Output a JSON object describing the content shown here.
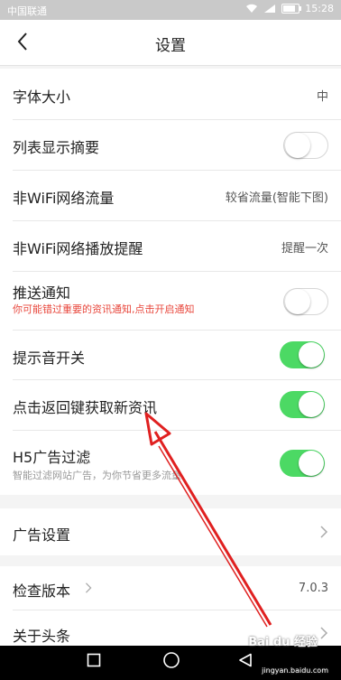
{
  "status_bar": {
    "carrier": "中国联通",
    "time": "15:28",
    "battery_level": 0.8
  },
  "header": {
    "title": "设置"
  },
  "settings": {
    "font_size": {
      "label": "字体大小",
      "value": "中"
    },
    "list_summary": {
      "label": "列表显示摘要",
      "enabled": false
    },
    "non_wifi_traffic": {
      "label": "非WiFi网络流量",
      "value": "较省流量(智能下图)"
    },
    "non_wifi_play": {
      "label": "非WiFi网络播放提醒",
      "value": "提醒一次"
    },
    "push": {
      "label": "推送通知",
      "subtitle": "你可能错过重要的资讯通知,点击开启通知",
      "enabled": false
    },
    "sound": {
      "label": "提示音开关",
      "enabled": true
    },
    "back_refresh": {
      "label": "点击返回键获取新资讯",
      "enabled": true
    },
    "h5_filter": {
      "label": "H5广告过滤",
      "subtitle": "智能过滤网站广告，为你节省更多流量",
      "enabled": true
    },
    "ads": {
      "label": "广告设置"
    },
    "version": {
      "label": "检查版本",
      "value": "7.0.3"
    },
    "about": {
      "label": "关于头条"
    }
  },
  "watermark": {
    "brand": "Bai du 经验",
    "url": "jingyan.baidu.com"
  },
  "colors": {
    "toggle_on": "#4cd964",
    "warning_text": "#e8473c",
    "arrow": "#e02020",
    "status_bar": "#c9c9c9"
  }
}
